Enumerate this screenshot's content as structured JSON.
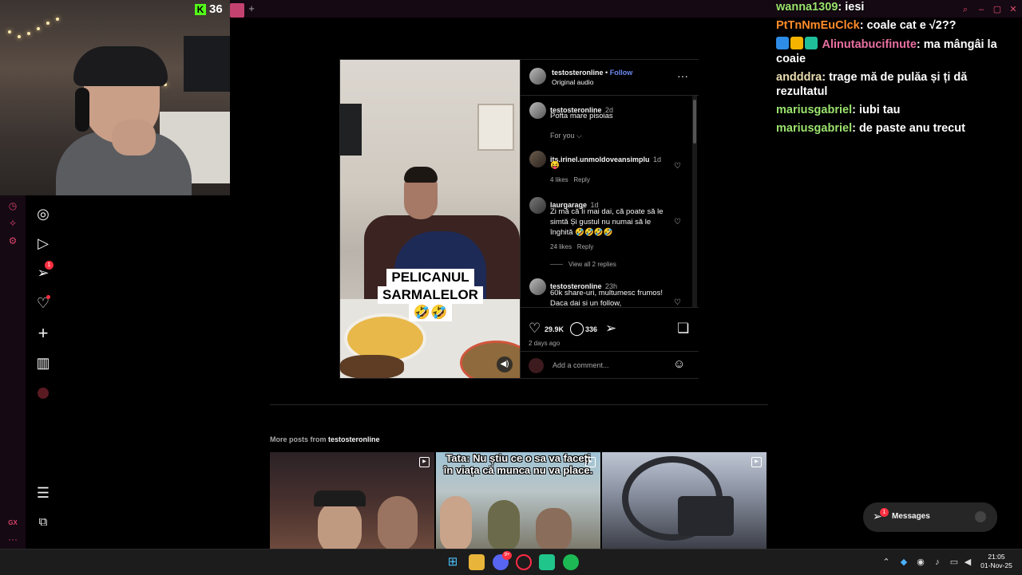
{
  "stream": {
    "viewer_count": "36",
    "logo_letter": "K"
  },
  "chat": [
    {
      "user": "wanna1309",
      "color": "#9be36e",
      "message": "iesi",
      "badges": []
    },
    {
      "user": "PtTnNmEuClck",
      "color": "#ff8c2a",
      "message": "coale cat e √2??",
      "badges": []
    },
    {
      "user": "Alinutabucifinute",
      "color": "#e86fa1",
      "message": "ma mângâi la coaie",
      "badges": [
        "#2e8be6",
        "#f6b400",
        "#1fbf9a"
      ]
    },
    {
      "user": "andddra",
      "color": "#e8dcb0",
      "message": "trage mă de pulăa și ți dă rezultatul",
      "badges": []
    },
    {
      "user": "mariusgabriel",
      "color": "#9be36e",
      "message": "iubi tau",
      "badges": []
    },
    {
      "user": "mariusgabriel",
      "color": "#9be36e",
      "message": "de paste anu trecut",
      "badges": []
    }
  ],
  "nav": {
    "icons": [
      "explore-icon",
      "reels-icon",
      "messages-icon",
      "notifications-icon",
      "create-icon",
      "dashboard-icon",
      "profile-icon"
    ],
    "messages_badge": "1",
    "bottom_icons": [
      "more-menu-icon",
      "also-from-meta-icon"
    ]
  },
  "opera": {
    "gx_label": "GX",
    "more": "···"
  },
  "post": {
    "author": "testosteronline",
    "follow": "Follow",
    "audio": "Original audio",
    "media_caption_1": "PELICANUL",
    "media_caption_2": "SARMALELOR",
    "media_emoji": "🤣🤣",
    "caption_time": "2d",
    "caption_text": "Pofta mare pisoias",
    "sort_label": "For you ⌵",
    "comments": [
      {
        "user": "its.irinel.unmoldoveansimplu",
        "time": "1d",
        "text": "😝",
        "likes": "4 likes",
        "reply": "Reply"
      },
      {
        "user": "laurgarage",
        "time": "1d",
        "text": "Zi mă că Îi mai dai, că poate să le simtă Și gustul nu numai să le înghită 🤣🤣🤣🤣",
        "likes": "24 likes",
        "reply": "Reply",
        "view_replies": "View all 2 replies"
      },
      {
        "user": "testosteronline",
        "time": "23h",
        "text": "60k share-uri, multumesc frumos! Daca dai si un follow,",
        "likes": "",
        "reply": ""
      }
    ],
    "likes": "29.9K",
    "comment_count": "336",
    "posted": "2 days ago",
    "add_comment_placeholder": "Add a comment..."
  },
  "more_posts": {
    "label": "More posts from",
    "author": "testosteronline",
    "tiles": [
      {
        "caption": ""
      },
      {
        "caption": "Tata: Nu știu ce o sa va faceți în viața că munca nu va place."
      },
      {
        "caption": ""
      }
    ]
  },
  "messages_pill": {
    "label": "Messages",
    "badge": "1"
  },
  "taskbar": {
    "time": "21:05",
    "date": "01-Nov-25",
    "discord_badge": "9+"
  }
}
